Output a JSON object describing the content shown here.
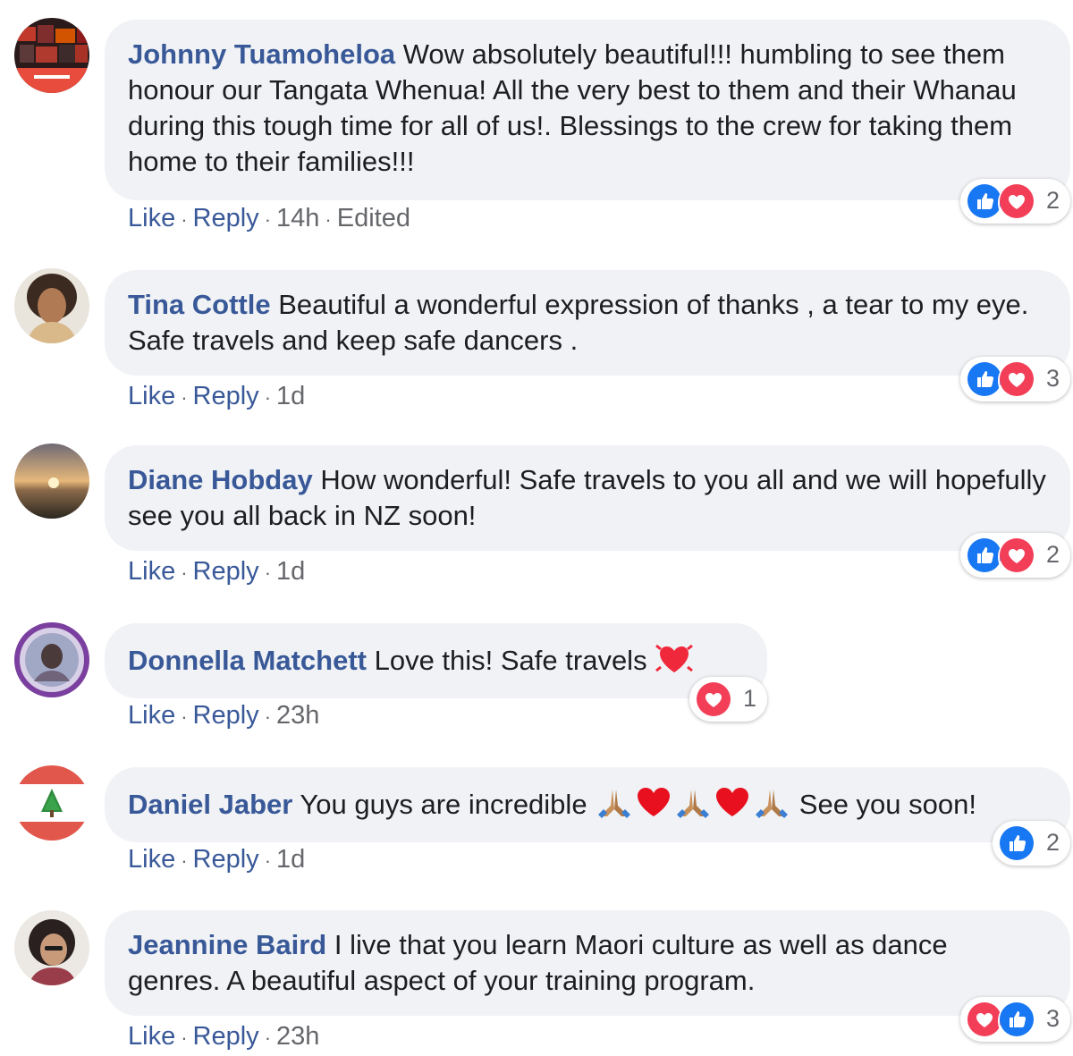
{
  "comments": [
    {
      "name": "Johnny Tuamoheloa",
      "text": " Wow absolutely beautiful!!! humbling to see them honour our Tangata Whenua! All the very best to them and their Whanau during this tough time for all of us!. Blessings to the crew for taking them home to their families!!!",
      "actions": {
        "like": "Like",
        "reply": "Reply",
        "time": "14h",
        "edited": "Edited"
      },
      "reactions": {
        "icons": [
          "like-icon",
          "love-icon"
        ],
        "count": "2"
      }
    },
    {
      "name": "Tina Cottle",
      "text": " Beautiful a wonderful expression of thanks , a tear to my eye. Safe travels and keep safe dancers .",
      "actions": {
        "like": "Like",
        "reply": "Reply",
        "time": "1d"
      },
      "reactions": {
        "icons": [
          "like-icon",
          "love-icon"
        ],
        "count": "3"
      }
    },
    {
      "name": "Diane Hobday",
      "text": " How wonderful! Safe travels to you all and we will hopefully see you all back in NZ soon!",
      "actions": {
        "like": "Like",
        "reply": "Reply",
        "time": "1d"
      },
      "reactions": {
        "icons": [
          "like-icon",
          "love-icon"
        ],
        "count": "2"
      }
    },
    {
      "name": "Donnella Matchett",
      "text": " Love this! Safe travels ",
      "emoji": [
        "heart-sparkle-emoji"
      ],
      "actions": {
        "like": "Like",
        "reply": "Reply",
        "time": "23h"
      },
      "reactions": {
        "icons": [
          "love-icon"
        ],
        "count": "1"
      }
    },
    {
      "name": "Daniel Jaber",
      "text_before": " You guys are incredible ",
      "emoji": [
        "folded-hands-emoji",
        "red-heart-emoji",
        "folded-hands-emoji",
        "red-heart-emoji",
        "folded-hands-emoji"
      ],
      "text_after": " See you soon!",
      "actions": {
        "like": "Like",
        "reply": "Reply",
        "time": "1d"
      },
      "reactions": {
        "icons": [
          "like-icon"
        ],
        "count": "2"
      }
    },
    {
      "name": "Jeannine Baird",
      "text": " I live that you learn Maori culture as well as dance genres. A beautiful aspect of your training program.",
      "actions": {
        "like": "Like",
        "reply": "Reply",
        "time": "23h"
      },
      "reactions": {
        "icons": [
          "love-icon",
          "like-icon"
        ],
        "count": "3"
      }
    }
  ],
  "colors": {
    "name": "#385898",
    "bubble": "#f0f2f5",
    "meta": "#65676b",
    "like": "#1877f2",
    "love": "#f33e58"
  }
}
